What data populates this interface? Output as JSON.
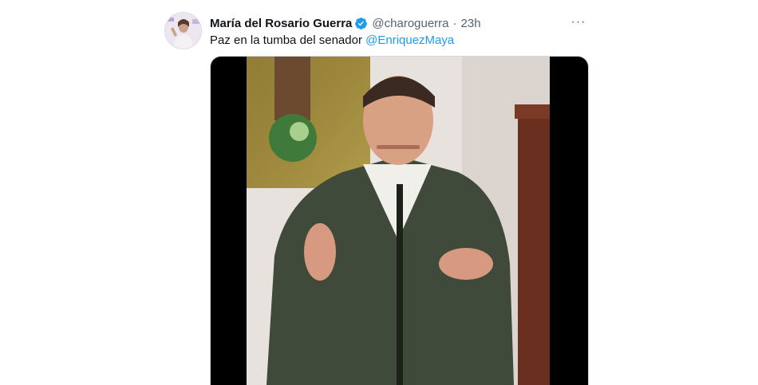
{
  "tweet": {
    "author_name": "María del Rosario Guerra",
    "handle": "@charoguerra",
    "separator": "·",
    "time": "23h",
    "text_before": "Paz en la tumba del senador ",
    "mention": "@EnriquezMaya",
    "more_label": "···"
  },
  "icons": {
    "verified": "verified-badge-icon",
    "more": "more-horizontal-icon"
  },
  "colors": {
    "link": "#1d9bf0",
    "secondary_text": "#536471",
    "primary_text": "#0f1419",
    "verified": "#1d9bf0"
  }
}
